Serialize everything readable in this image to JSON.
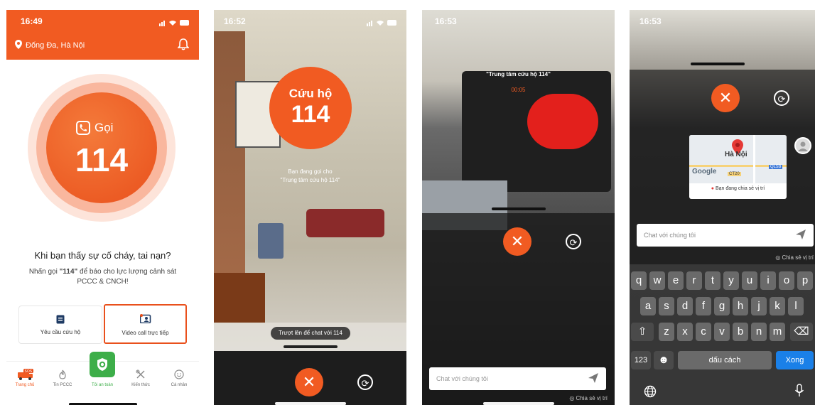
{
  "screen1": {
    "time": "16:49",
    "location": "Đống Đa, Hà Nội",
    "call_label": "Gọi",
    "call_number": "114",
    "headline": "Khi bạn thấy sự cố cháy, tai nạn?",
    "desc_prefix": "Nhấn gọi ",
    "desc_number": "\"114\"",
    "desc_suffix": " để báo cho lực lượng cảnh sát",
    "desc_line2": "PCCC & CNCH!",
    "card_rescue": "Yêu cầu cứu hộ",
    "card_video": "Video call trực tiếp",
    "nav": [
      {
        "label": "Trang chủ",
        "icon": "sos-truck-icon",
        "active": true
      },
      {
        "label": "Tin PCCC",
        "icon": "fire-icon",
        "active": false
      },
      {
        "label": "Tôi an toàn",
        "icon": "shield-check-icon",
        "active": false
      },
      {
        "label": "Kiến thức",
        "icon": "tools-icon",
        "active": false
      },
      {
        "label": "Cá nhân",
        "icon": "profile-icon",
        "active": false
      }
    ],
    "colors": {
      "brand": "#f15b22",
      "accent_green": "#3dae49"
    }
  },
  "screen2": {
    "time": "16:52",
    "badge_line1": "Cứu hộ",
    "badge_line2": "114",
    "calling_line1": "Bạn đang gọi cho",
    "calling_line2": "\"Trung tâm cứu hộ 114\"",
    "swipe_hint": "Trượt lên để chat với 114"
  },
  "screen3": {
    "time": "16:53",
    "caller": "\"Trung tâm cứu hộ 114\"",
    "timer": "00:05",
    "chat_placeholder": "Chat với chúng tôi",
    "share_location": "Chia sẻ vị trí"
  },
  "screen4": {
    "time": "16:53",
    "map_city": "Hà Nội",
    "map_brand": "Google",
    "map_road1": "CT20",
    "map_road2": "QL5B",
    "sharing_status": "Bạn đang chia sẻ vị trí",
    "chat_placeholder": "Chat với chúng tôi",
    "share_location": "Chia sẻ vị trí",
    "keyboard": {
      "row1": [
        "q",
        "w",
        "e",
        "r",
        "t",
        "y",
        "u",
        "i",
        "o",
        "p"
      ],
      "row2": [
        "a",
        "s",
        "d",
        "f",
        "g",
        "h",
        "j",
        "k",
        "l"
      ],
      "row3": [
        "z",
        "x",
        "c",
        "v",
        "b",
        "n",
        "m"
      ],
      "numbers_key": "123",
      "space_key": "dấu cách",
      "done_key": "Xong"
    }
  }
}
